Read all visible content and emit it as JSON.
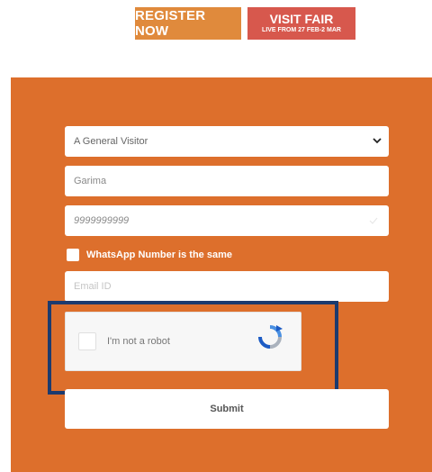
{
  "header": {
    "register_label": "REGISTER NOW",
    "visit_label": "VISIT FAIR",
    "visit_sublabel": "LIVE FROM 27 FEB-2 MAR"
  },
  "form": {
    "visitor_type": {
      "selected": "A General Visitor"
    },
    "name_field": {
      "value": "Garima"
    },
    "phone_field": {
      "value": "9999999999"
    },
    "whatsapp": {
      "label": "WhatsApp Number is the same",
      "checked": false
    },
    "email_field": {
      "placeholder": "Email ID"
    },
    "captcha": {
      "label": "I'm not a robot"
    },
    "submit_label": "Submit"
  },
  "colors": {
    "panel": "#dd6f2c",
    "register_button": "#e08a3c",
    "visit_button": "#d7584d",
    "highlight_outline": "#1c3a6e"
  },
  "icons": {
    "select_chevron": "chevron-down-icon",
    "captcha_logo": "recaptcha-icon"
  }
}
